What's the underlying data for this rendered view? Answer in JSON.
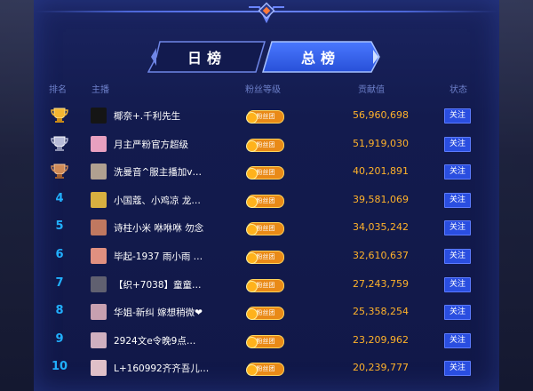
{
  "tabs": {
    "day": "日榜",
    "total": "总榜",
    "active": "total"
  },
  "columns": {
    "rank": "排名",
    "anchor": "主播",
    "fan_level": "粉丝等级",
    "score": "贡献值",
    "status": "状态"
  },
  "fan_badge_label": "粉丝团",
  "rows": [
    {
      "rank": "1",
      "trophy": "gold",
      "name": "椰奈+.千利先生",
      "score": "56,960,698",
      "follow": "关注",
      "avatar_color": "#151515"
    },
    {
      "rank": "2",
      "trophy": "silver",
      "name": "月主严粉官方超级",
      "score": "51,919,030",
      "follow": "关注",
      "avatar_color": "#e8a0c0"
    },
    {
      "rank": "3",
      "trophy": "bronze",
      "name": "洗曼音^服主播加v…",
      "score": "40,201,891",
      "follow": "关注",
      "avatar_color": "#b0a090"
    },
    {
      "rank": "4",
      "trophy": "",
      "name": "小国蔻、小鸡凉 龙…",
      "score": "39,581,069",
      "follow": "关注",
      "avatar_color": "#d8b040"
    },
    {
      "rank": "5",
      "trophy": "",
      "name": "诗柱小米 咻咻咻 勿念",
      "score": "34,035,242",
      "follow": "关注",
      "avatar_color": "#c07860"
    },
    {
      "rank": "6",
      "trophy": "",
      "name": "毕起-1937 雨小雨 …",
      "score": "32,610,637",
      "follow": "关注",
      "avatar_color": "#e09080"
    },
    {
      "rank": "7",
      "trophy": "",
      "name": "【织+7038】童童…",
      "score": "27,243,759",
      "follow": "关注",
      "avatar_color": "#606070"
    },
    {
      "rank": "8",
      "trophy": "",
      "name": "华姐-新纠 嫁想稍微❤",
      "score": "25,358,254",
      "follow": "关注",
      "avatar_color": "#c8a0b0"
    },
    {
      "rank": "9",
      "trophy": "",
      "name": "2924文e令晚9点…",
      "score": "23,209,962",
      "follow": "关注",
      "avatar_color": "#d0b0c0"
    },
    {
      "rank": "10",
      "trophy": "",
      "name": "L+160992齐齐吾儿…",
      "score": "20,239,777",
      "follow": "关注",
      "avatar_color": "#e0c0c8"
    }
  ]
}
